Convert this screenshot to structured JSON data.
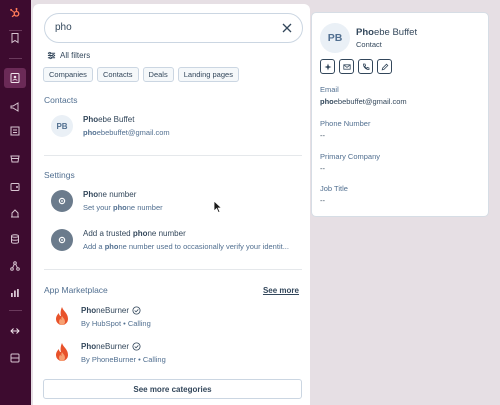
{
  "nav": {
    "items": [
      {
        "icon": "bookmark-icon"
      },
      {
        "icon": "contacts-icon",
        "active": true
      },
      {
        "icon": "megaphone-icon"
      },
      {
        "icon": "content-icon"
      },
      {
        "icon": "commerce-icon"
      },
      {
        "icon": "service-icon"
      },
      {
        "icon": "automation-icon"
      },
      {
        "icon": "database-icon"
      },
      {
        "icon": "partners-icon"
      },
      {
        "icon": "reporting-icon"
      },
      {
        "icon": "expand-icon"
      },
      {
        "icon": "sidebar-icon"
      }
    ]
  },
  "search": {
    "value": "pho",
    "all_filters": "All filters",
    "chips": [
      "Companies",
      "Contacts",
      "Deals",
      "Landing pages"
    ]
  },
  "sections": {
    "contacts": {
      "title": "Contacts",
      "items": [
        {
          "initials": "PB",
          "title_match": "Pho",
          "title_rest": "ebe Buffet",
          "sub_match": "pho",
          "sub_rest": "ebebuffet@gmail.com"
        }
      ]
    },
    "settings": {
      "title": "Settings",
      "items": [
        {
          "title_match": "Pho",
          "title_rest": "ne number",
          "sub_pre": "Set your ",
          "sub_match": "pho",
          "sub_rest": "ne number"
        },
        {
          "title_pre": "Add a trusted ",
          "title_match": "pho",
          "title_rest": "ne number",
          "sub_pre": "Add a ",
          "sub_match": "pho",
          "sub_rest": "ne number used to occasionally verify your identit..."
        }
      ]
    },
    "marketplace": {
      "title": "App Marketplace",
      "see_more": "See more",
      "items": [
        {
          "title_match": "Pho",
          "title_rest": "neBurner",
          "sub": "By HubSpot • Calling"
        },
        {
          "title_match": "Pho",
          "title_rest": "neBurner",
          "sub": "By PhoneBurner • Calling"
        }
      ]
    },
    "more_categories": "See more categories"
  },
  "preview": {
    "initials": "PB",
    "name_match": "Pho",
    "name_rest": "ebe Buffet",
    "type": "Contact",
    "fields": [
      {
        "label": "Email",
        "value_match": "pho",
        "value_rest": "ebebuffet@gmail.com"
      },
      {
        "label": "Phone Number",
        "value_match": "",
        "value_rest": "--"
      },
      {
        "label": "Primary Company",
        "value_match": "",
        "value_rest": "--"
      },
      {
        "label": "Job Title",
        "value_match": "",
        "value_rest": "--"
      }
    ]
  },
  "colors": {
    "rail": "#3d0b2f",
    "flame": "#e8522a",
    "text": "#33475b"
  }
}
